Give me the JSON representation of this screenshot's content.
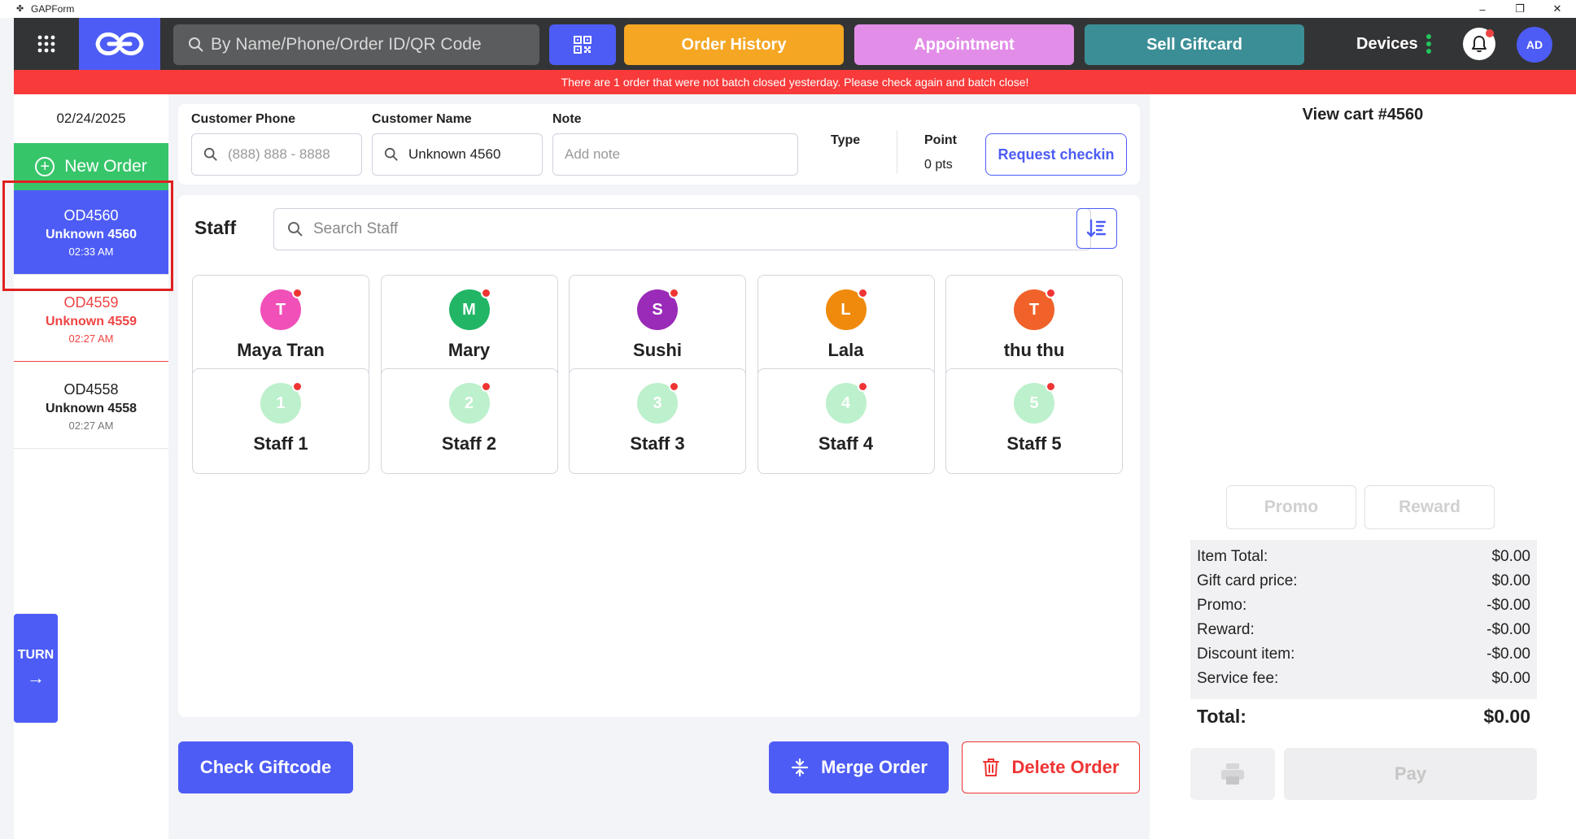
{
  "window": {
    "title": "GAPForm",
    "controls": {
      "minimize": "–",
      "maximize": "❐",
      "close": "✕"
    }
  },
  "topnav": {
    "search_placeholder": "By Name/Phone/Order ID/QR Code",
    "order_history": "Order History",
    "appointment": "Appointment",
    "sell_giftcard": "Sell Giftcard",
    "devices": "Devices",
    "avatar_initials": "AD",
    "colors": {
      "order_history": "#f5a623",
      "appointment": "#e28ee8",
      "sell_giftcard": "#3c8e96",
      "brand": "#4d5cf5"
    }
  },
  "alert": {
    "message": "There are 1 order that were not batch closed yesterday. Please check again and batch close!"
  },
  "sidebar": {
    "date": "02/24/2025",
    "new_order": "New Order",
    "orders": [
      {
        "id": "OD4560",
        "name": "Unknown 4560",
        "time": "02:33 AM",
        "state": "active"
      },
      {
        "id": "OD4559",
        "name": "Unknown 4559",
        "time": "02:27 AM",
        "state": "warning"
      },
      {
        "id": "OD4558",
        "name": "Unknown 4558",
        "time": "02:27 AM",
        "state": "normal"
      }
    ],
    "turn": "TURN",
    "turn_arrow": "→"
  },
  "customer": {
    "phone_label": "Customer Phone",
    "phone_placeholder": "(888) 888 - 8888",
    "name_label": "Customer Name",
    "name_value": "Unknown 4560",
    "note_label": "Note",
    "note_placeholder": "Add note",
    "type_label": "Type",
    "point_label": "Point",
    "point_value": "0 pts",
    "request_checkin": "Request checkin"
  },
  "staff": {
    "title": "Staff",
    "search_placeholder": "Search Staff",
    "members": [
      {
        "initial": "T",
        "name": "Maya Tran",
        "color": "#f050b8"
      },
      {
        "initial": "M",
        "name": "Mary",
        "color": "#22b566"
      },
      {
        "initial": "S",
        "name": "Sushi",
        "color": "#9a2ab8"
      },
      {
        "initial": "L",
        "name": "Lala",
        "color": "#f08a0c"
      },
      {
        "initial": "T",
        "name": "thu thu",
        "color": "#f0622a"
      },
      {
        "initial": "1",
        "name": "Staff 1",
        "color": "#bdf0cc"
      },
      {
        "initial": "2",
        "name": "Staff 2",
        "color": "#bdf0cc"
      },
      {
        "initial": "3",
        "name": "Staff 3",
        "color": "#bdf0cc"
      },
      {
        "initial": "4",
        "name": "Staff 4",
        "color": "#bdf0cc"
      },
      {
        "initial": "5",
        "name": "Staff 5",
        "color": "#bdf0cc"
      }
    ]
  },
  "actions": {
    "check_giftcode": "Check Giftcode",
    "merge_order": "Merge Order",
    "delete_order": "Delete Order"
  },
  "cart": {
    "title": "View cart #4560",
    "promo": "Promo",
    "reward": "Reward",
    "summary": [
      {
        "label": "Item Total:",
        "value": "$0.00"
      },
      {
        "label": "Gift card price:",
        "value": "$0.00"
      },
      {
        "label": "Promo:",
        "value": "-$0.00"
      },
      {
        "label": "Reward:",
        "value": "-$0.00"
      },
      {
        "label": "Discount item:",
        "value": "-$0.00"
      },
      {
        "label": "Service fee:",
        "value": "$0.00"
      }
    ],
    "total_label": "Total:",
    "total_value": "$0.00",
    "pay": "Pay"
  }
}
